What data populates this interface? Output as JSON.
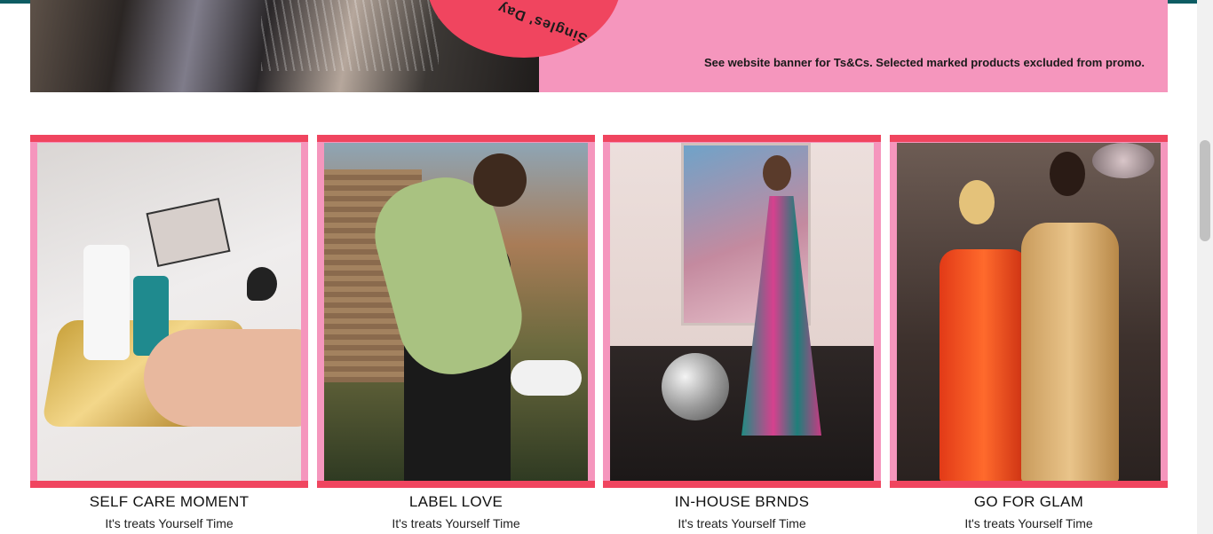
{
  "banner": {
    "badge_text": "Singles' Day",
    "terms_text": "See website banner for Ts&Cs. Selected marked products excluded from promo."
  },
  "cards": [
    {
      "title": "SELF CARE MOMENT",
      "subtitle": "It's treats Yourself Time"
    },
    {
      "title": "LABEL LOVE",
      "subtitle": "It's treats Yourself Time"
    },
    {
      "title": "IN-HOUSE BRNDS",
      "subtitle": "It's treats Yourself Time"
    },
    {
      "title": "GO FOR GLAM",
      "subtitle": "It's treats Yourself Time"
    }
  ],
  "colors": {
    "accent_red": "#f0455f",
    "accent_pink": "#f596bd",
    "top_bar": "#0d5c63"
  }
}
